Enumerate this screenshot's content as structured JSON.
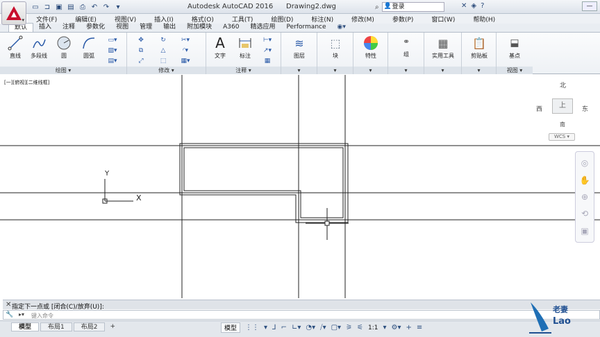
{
  "app": {
    "title": "Autodesk AutoCAD 2016",
    "file": "Drawing2.dwg"
  },
  "search": {
    "login_label": "登录"
  },
  "menu": [
    "文件(F)",
    "编辑(E)",
    "视图(V)",
    "插入(I)",
    "格式(O)",
    "工具(T)",
    "绘图(D)",
    "标注(N)",
    "修改(M)",
    "参数(P)",
    "窗口(W)",
    "帮助(H)"
  ],
  "ribbon_tabs": [
    "默认",
    "插入",
    "注释",
    "参数化",
    "视图",
    "管理",
    "输出",
    "附加模块",
    "A360",
    "精选应用",
    "Performance"
  ],
  "ribbon": {
    "draw": {
      "title": "绘图",
      "buttons": [
        "直线",
        "多段线",
        "圆",
        "圆弧"
      ]
    },
    "modify": {
      "title": "修改"
    },
    "annotation": {
      "title": "注释",
      "buttons": [
        "文字",
        "标注"
      ]
    },
    "layers": {
      "label": "图层"
    },
    "block": {
      "label": "块"
    },
    "properties": {
      "label": "特性"
    },
    "groups": {
      "label": "组"
    },
    "utilities": {
      "label": "实用工具"
    },
    "clipboard": {
      "label": "剪贴板"
    },
    "view": {
      "label": "基点",
      "title": "视图"
    }
  },
  "viewport": {
    "label": "[一][俯视][二维线框]",
    "ucs": {
      "y_label": "Y",
      "x_label": "X"
    },
    "viewcube": {
      "north": "北",
      "south": "南",
      "east": "东",
      "west": "西",
      "face": "上",
      "wcs": "WCS"
    }
  },
  "command": {
    "history": "指定下一点或 [闭合(C)/放弃(U)]:",
    "placeholder": "键入命令"
  },
  "status": {
    "layout_tabs": [
      "模型",
      "布局1",
      "布局2"
    ],
    "model_button": "模型",
    "scale": "1:1"
  },
  "watermark": {
    "cn": "老妻",
    "en": "Lao"
  }
}
